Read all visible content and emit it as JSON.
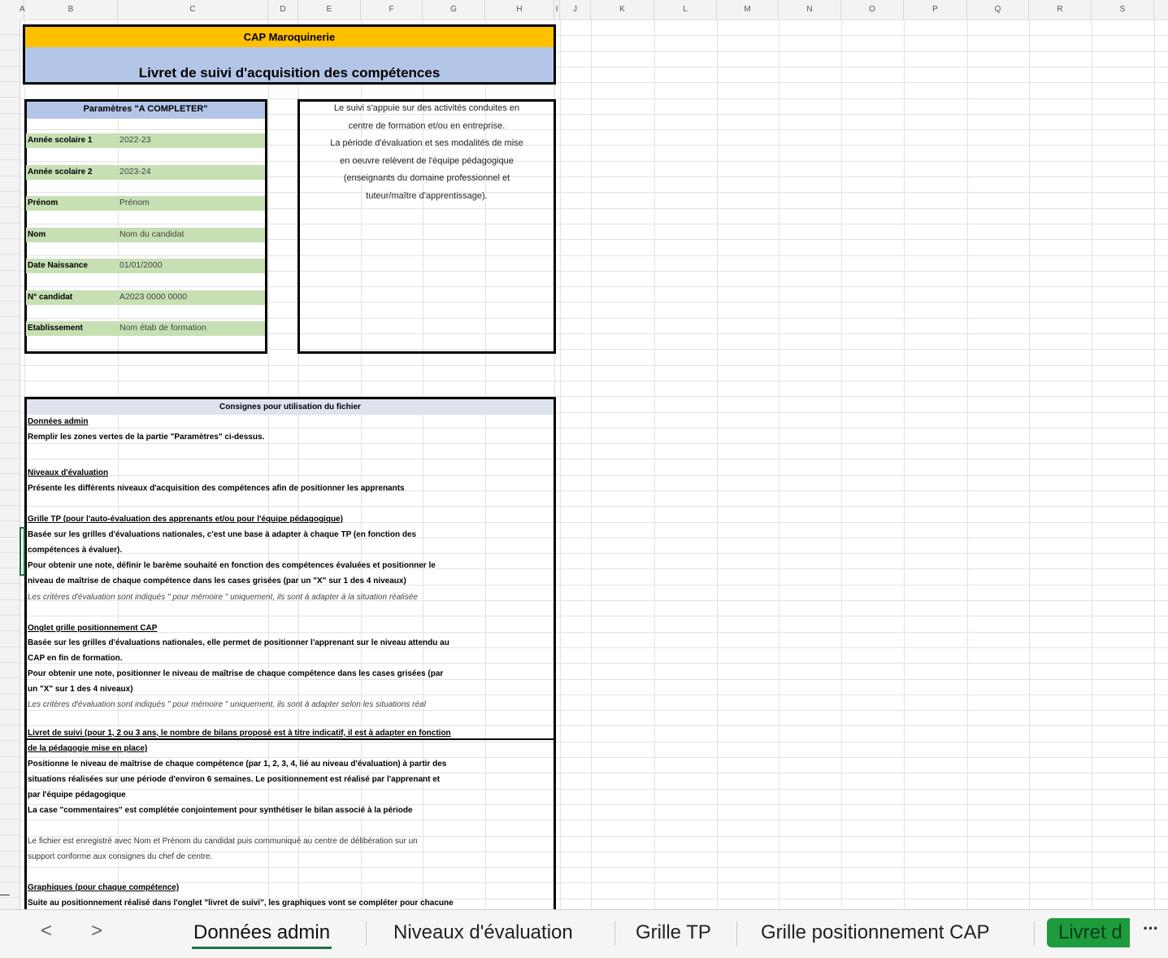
{
  "columns": [
    "A",
    "B",
    "C",
    "D",
    "E",
    "F",
    "G",
    "H",
    "I",
    "J",
    "K",
    "L",
    "M",
    "N",
    "O",
    "P",
    "Q",
    "R",
    "S"
  ],
  "header": {
    "title": "CAP Maroquinerie",
    "subtitle": "Livret de suivi d'acquisition des compétences"
  },
  "params": {
    "title": "Paramètres \"A COMPLETER\"",
    "rows": [
      {
        "label": "Année scolaire 1",
        "value": "2022-23"
      },
      {
        "label": "Année scolaire 2",
        "value": "2023-24"
      },
      {
        "label": "Prénom",
        "value": "Prénom"
      },
      {
        "label": "Nom",
        "value": "Nom du candidat"
      },
      {
        "label": "Date Naissance",
        "value": "01/01/2000"
      },
      {
        "label": "N° candidat",
        "value": "A2023 0000 0000"
      },
      {
        "label": "Etablissement",
        "value": "Nom étab de formation"
      }
    ]
  },
  "info": {
    "lines": [
      "Le suivi s'appuie sur des activités conduites en",
      "centre de formation et/ou en entreprise.",
      "La période d'évaluation et ses modalités de mise",
      "en oeuvre relèvent de l'équipe pédagogique",
      "(enseignants du domaine professionnel et",
      "tuteur/maître d'apprentissage)."
    ]
  },
  "instructions": {
    "title": "Consignes pour utilisation du fichier",
    "lines": [
      "Données admin",
      "Remplir les zones vertes de la partie \"Paramètres\" ci-dessus.",
      "Niveaux d'évaluation",
      "Présente les différents niveaux d'acquisition des compétences afin de positionner les apprenants",
      "Grille TP (pour l'auto-évaluation des apprenants et/ou pour l'équipe pédagogique)",
      "Basée sur les grilles d'évaluations nationales, c'est une base à adapter à chaque TP (en fonction des",
      "compétences à évaluer).",
      "Pour obtenir une note, définir le barème souhaité en fonction des compétences évaluées et positionner le",
      "niveau de maîtrise de chaque compétence dans les cases grisées (par un \"X\" sur 1 des 4 niveaux)",
      "Les critères d'évaluation sont indiqués \" pour mémoire \" uniquement, ils sont à adapter à la situation réalisée",
      "Onglet grille positionnement CAP",
      "Basée sur les grilles d'évaluations nationales, elle permet de positionner l'apprenant sur le niveau attendu au",
      "CAP en fin de formation.",
      "Pour obtenir une note, positionner le niveau de maîtrise de chaque compétence dans les cases grisées (par",
      "un \"X\" sur 1 des 4 niveaux)",
      "Les critères d'évaluation sont indiqués \" pour mémoire \" uniquement, ils sont à adapter selon les situations réal",
      "Livret de suivi (pour 1, 2 ou 3 ans, le nombre de bilans proposé est à titre indicatif, il est à adapter en fonction",
      "de la pédagogie mise en place)",
      "Positionne le niveau de maîtrise de chaque compétence (par 1, 2, 3, 4, lié au niveau d'évaluation) à partir des",
      "situations réalisées sur une période d'environ 6 semaines. Le positionnement est réalisé par l'apprenant et",
      "par l'équipe pédagogique",
      "La case \"commentaires\" est complétée conjointement pour synthétiser le bilan associé à la période",
      "Le fichier est enregistré avec Nom et Prénom du candidat puis communiqué au centre de délibération sur un",
      "support conforme aux consignes du chef de centre.",
      "Graphiques (pour chaque compétence)",
      "Suite au positionnement réalisé dans l'onglet \"livret de suivi\", les graphiques vont se compléter pour chacune"
    ]
  },
  "tabs": {
    "active": "Données admin",
    "items": [
      "Niveaux d'évaluation",
      "Grille TP",
      "Grille positionnement CAP"
    ],
    "green": "Livret d",
    "more": "···",
    "prev": "<",
    "next": ">"
  },
  "colors": {
    "title_fill": "#ffc000",
    "subtitle_fill": "#b4c6e7",
    "green_fill": "#c6e0b4",
    "active_tab": "#1e7145",
    "green_tab": "#1e9b3c"
  }
}
